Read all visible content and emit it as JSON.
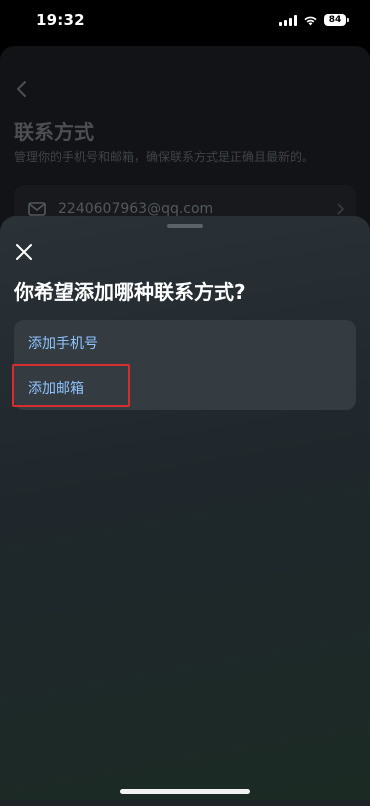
{
  "status_bar": {
    "time": "19:32",
    "battery": "84"
  },
  "background_page": {
    "title": "联系方式",
    "description": "管理你的手机号和邮箱，确保联系方式是正确且最新的。",
    "contact_email": "2240607963@qq.com"
  },
  "sheet": {
    "title": "你希望添加哪种联系方式?",
    "options": [
      {
        "label": "添加手机号"
      },
      {
        "label": "添加邮箱"
      }
    ]
  },
  "colors": {
    "option_text": "#8fc4ff",
    "highlight_border": "#d92c2c"
  }
}
